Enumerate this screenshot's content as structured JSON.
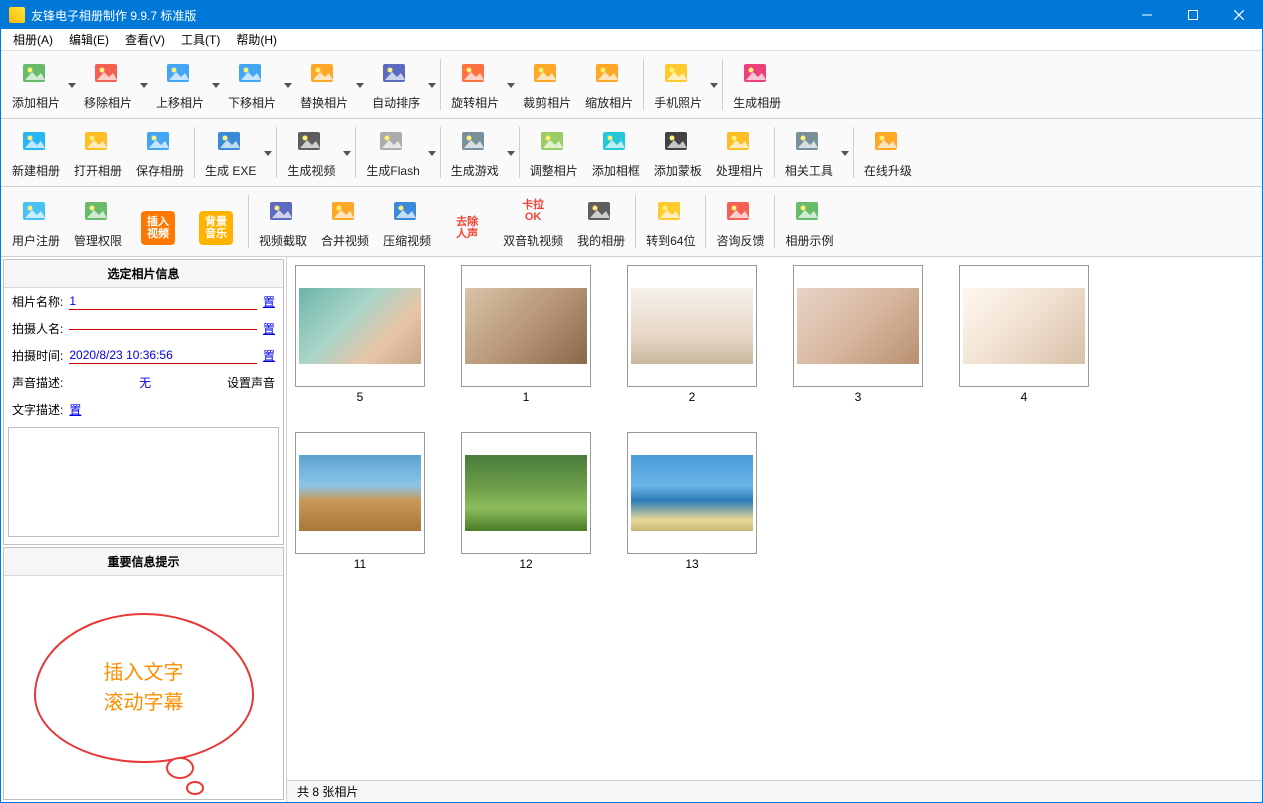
{
  "titlebar": {
    "title": "友锋电子相册制作 9.9.7 标准版"
  },
  "menu": [
    "相册(A)",
    "编辑(E)",
    "查看(V)",
    "工具(T)",
    "帮助(H)"
  ],
  "toolbar1": [
    {
      "name": "add-photo",
      "label": "添加相片",
      "icon": "photo-plus",
      "color": "#4caf50",
      "dd": true
    },
    {
      "name": "remove-photo",
      "label": "移除相片",
      "icon": "photo-minus",
      "color": "#f44336",
      "dd": true
    },
    {
      "name": "move-up-photo",
      "label": "上移相片",
      "icon": "photo-up",
      "color": "#2196f3",
      "dd": true
    },
    {
      "name": "move-down-photo",
      "label": "下移相片",
      "icon": "photo-down",
      "color": "#2196f3",
      "dd": true
    },
    {
      "name": "replace-photo",
      "label": "替换相片",
      "icon": "photo-swap",
      "color": "#ff9800",
      "dd": true
    },
    {
      "name": "auto-sort",
      "label": "自动排序",
      "icon": "sort",
      "color": "#3f51b5",
      "dd": true
    },
    {
      "sep": true
    },
    {
      "name": "rotate-photo",
      "label": "旋转相片",
      "icon": "rotate",
      "color": "#ff5722",
      "dd": true
    },
    {
      "name": "crop-photo",
      "label": "裁剪相片",
      "icon": "crop",
      "color": "#ff9800"
    },
    {
      "name": "scale-photo",
      "label": "缩放相片",
      "icon": "scale",
      "color": "#ff9800"
    },
    {
      "sep": true
    },
    {
      "name": "phone-photo",
      "label": "手机照片",
      "icon": "phone",
      "color": "#ffc107",
      "dd": true
    },
    {
      "sep": true
    },
    {
      "name": "generate-album",
      "label": "生成相册",
      "icon": "generate",
      "color": "#e91e63"
    }
  ],
  "toolbar2": [
    {
      "name": "new-album",
      "label": "新建相册",
      "icon": "new",
      "color": "#03a9f4"
    },
    {
      "name": "open-album",
      "label": "打开相册",
      "icon": "open",
      "color": "#ffb300"
    },
    {
      "name": "save-album",
      "label": "保存相册",
      "icon": "save",
      "color": "#2196f3"
    },
    {
      "sep": true
    },
    {
      "name": "generate-exe",
      "label": "生成 EXE",
      "icon": "exe",
      "color": "#1976d2",
      "dd": true
    },
    {
      "sep": true
    },
    {
      "name": "generate-video",
      "label": "生成视频",
      "icon": "video",
      "color": "#424242",
      "dd": true
    },
    {
      "sep": true
    },
    {
      "name": "generate-flash",
      "label": "生成Flash",
      "icon": "flash",
      "color": "#9e9e9e",
      "dd": true
    },
    {
      "sep": true
    },
    {
      "name": "generate-game",
      "label": "生成游戏",
      "icon": "game",
      "color": "#607d8b",
      "dd": true
    },
    {
      "sep": true
    },
    {
      "name": "adjust-photo",
      "label": "调整相片",
      "icon": "adjust",
      "color": "#8bc34a"
    },
    {
      "name": "add-frame",
      "label": "添加相框",
      "icon": "frame",
      "color": "#00bcd4"
    },
    {
      "name": "add-mask",
      "label": "添加蒙板",
      "icon": "mask",
      "color": "#212121"
    },
    {
      "name": "process-photo",
      "label": "处理相片",
      "icon": "process",
      "color": "#ffb300"
    },
    {
      "sep": true
    },
    {
      "name": "related-tools",
      "label": "相关工具",
      "icon": "tools",
      "color": "#607d8b",
      "dd": true
    },
    {
      "sep": true
    },
    {
      "name": "online-upgrade",
      "label": "在线升级",
      "icon": "upgrade",
      "color": "#ff9800"
    }
  ],
  "toolbar3": [
    {
      "name": "user-register",
      "label": "用户注册",
      "icon": "register",
      "color": "#29b6f6"
    },
    {
      "name": "manage-permission",
      "label": "管理权限",
      "icon": "shield",
      "color": "#4caf50"
    },
    {
      "name": "insert-video",
      "label2": "插入\n视频",
      "icon": "insert-video",
      "color": "#ff9800",
      "styled": true,
      "bg": "#ff7800"
    },
    {
      "name": "bg-music",
      "label2": "背景\n音乐",
      "icon": "music",
      "color": "#ff9800",
      "styled": true,
      "bg": "#ffb300"
    },
    {
      "sep": true
    },
    {
      "name": "video-capture",
      "label": "视频截取",
      "icon": "cut",
      "color": "#3f51b5"
    },
    {
      "name": "merge-video",
      "label": "合并视频",
      "icon": "merge",
      "color": "#ff9800"
    },
    {
      "name": "compress-video",
      "label": "压缩视频",
      "icon": "compress",
      "color": "#1976d2"
    },
    {
      "name": "remove-vocal",
      "label2": "去除\n人声",
      "icon": "vocal",
      "color": "#f44336",
      "styled": true,
      "fg": "#f44336"
    },
    {
      "name": "dual-track",
      "label2": "卡拉\nOK",
      "icon": "karaoke",
      "prelabel": "双音轨视频",
      "styled": true,
      "fg": "#f44336"
    },
    {
      "name": "my-album",
      "label": "我的相册",
      "icon": "album",
      "color": "#424242"
    },
    {
      "sep": true
    },
    {
      "name": "to-64bit",
      "label": "转到64位",
      "icon": "64bit",
      "color": "#ffc107"
    },
    {
      "sep": true
    },
    {
      "name": "feedback",
      "label": "咨询反馈",
      "icon": "feedback",
      "color": "#f44336"
    },
    {
      "sep": true
    },
    {
      "name": "album-example",
      "label": "相册示例",
      "icon": "example",
      "color": "#4caf50"
    }
  ],
  "sidebar": {
    "info_title": "选定相片信息",
    "rows": [
      {
        "key": "相片名称:",
        "val": "1",
        "chg": "置"
      },
      {
        "key": "拍摄人名:",
        "val": "",
        "chg": "置"
      },
      {
        "key": "拍摄时间:",
        "val": "2020/8/23 10:36:56",
        "chg": "置"
      }
    ],
    "sound_label": "声音描述:",
    "sound_val": "无",
    "set_sound": "设置声音",
    "text_label": "文字描述:",
    "text_chg": "置",
    "tip_title": "重要信息提示",
    "bubble_line1": "插入文字",
    "bubble_line2": "滚动字幕"
  },
  "thumbs": [
    {
      "n": "5",
      "g": "linear-gradient(135deg,#6bb5a8 0%,#a8d5c8 40%,#e8c4a8 70%,#c8a888 100%)"
    },
    {
      "n": "1",
      "g": "linear-gradient(135deg,#d8c4a8 0%,#b89878 50%,#886848 100%)"
    },
    {
      "n": "2",
      "g": "linear-gradient(180deg,#f5f0eb 0%,#e8d8c8 60%,#c8b8a0 100%)"
    },
    {
      "n": "3",
      "g": "linear-gradient(135deg,#e8d4c8 0%,#d8b8a0 50%,#b89070 100%)"
    },
    {
      "n": "4",
      "g": "linear-gradient(135deg,#fff8f0 0%,#f0e0d0 50%,#d8c0a8 100%)"
    },
    {
      "n": "11",
      "g": "linear-gradient(180deg,#5ba3d0 0%,#8cc5e8 40%,#c89858 60%,#a87838 100%)"
    },
    {
      "n": "12",
      "g": "linear-gradient(180deg,#4a7c3a 0%,#6b9c4a 40%,#8cbc5a 70%,#4a7c2a 100%)"
    },
    {
      "n": "13",
      "g": "linear-gradient(180deg,#4a9cd8 0%,#6bb5e8 40%,#2a7cb8 60%,#e8d898 85%,#c8b878 100%)"
    }
  ],
  "status": {
    "text": "共 8 张相片"
  }
}
